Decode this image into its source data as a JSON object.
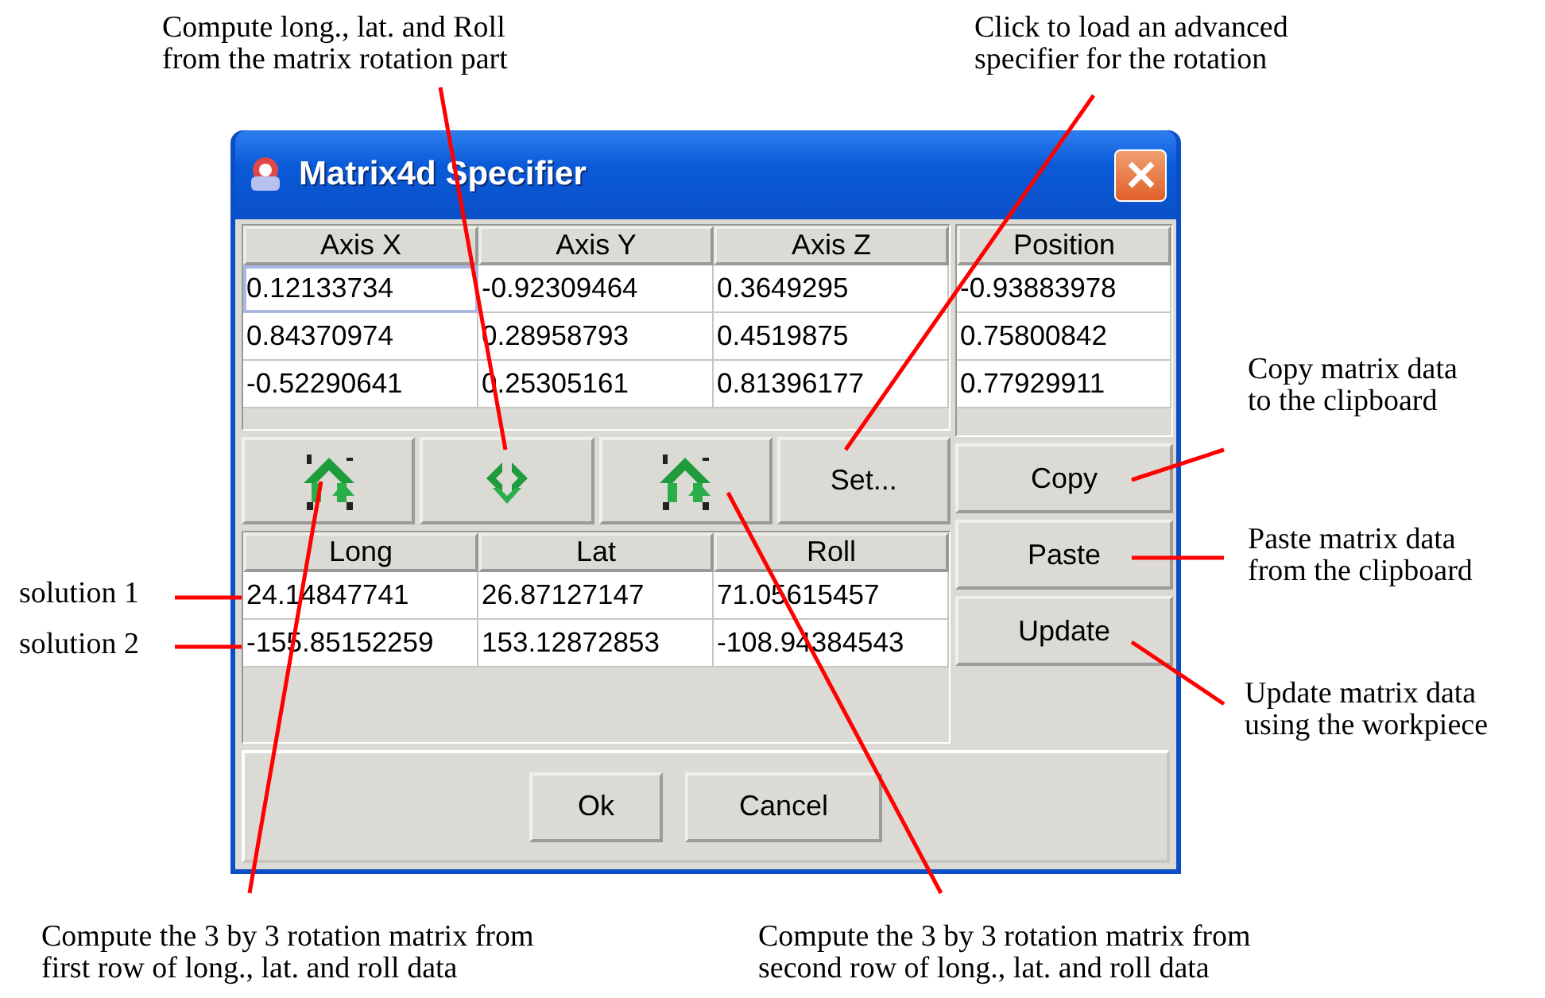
{
  "window": {
    "title": "Matrix4d Specifier"
  },
  "matrix_table": {
    "columns": [
      "Axis X",
      "Axis Y",
      "Axis Z"
    ],
    "rows": [
      {
        "cells": [
          {
            "value": "0.12133734",
            "selected": true
          },
          {
            "value": "-0.92309464",
            "selected": false
          },
          {
            "value": "0.3649295",
            "selected": false
          }
        ]
      },
      {
        "cells": [
          {
            "value": "0.84370974",
            "selected": false
          },
          {
            "value": "0.28958793",
            "selected": false
          },
          {
            "value": "0.4519875",
            "selected": false
          }
        ]
      },
      {
        "cells": [
          {
            "value": "-0.52290641",
            "selected": false
          },
          {
            "value": "0.25305161",
            "selected": false
          },
          {
            "value": "0.81396177",
            "selected": false
          }
        ]
      }
    ]
  },
  "position_table": {
    "column": "Position",
    "rows": [
      "-0.93883978",
      "0.75800842",
      "0.77929911"
    ]
  },
  "rotation_buttons": [
    {
      "kind": "row1-to-matrix"
    },
    {
      "kind": "matrix-to-angles"
    },
    {
      "kind": "row2-to-matrix"
    },
    {
      "kind": "text",
      "label": "Set..."
    }
  ],
  "angles_table": {
    "columns": [
      "Long",
      "Lat",
      "Roll"
    ],
    "rows": [
      [
        "24.14847741",
        "26.87127147",
        "71.05615457"
      ],
      [
        "-155.85152259",
        "153.12872853",
        "-108.94384543"
      ]
    ]
  },
  "side_buttons": [
    "Copy",
    "Paste",
    "Update"
  ],
  "dialog_buttons": [
    "Ok",
    "Cancel"
  ],
  "annotations": [
    {
      "text": "Compute long., lat. and Roll\nfrom the matrix rotation part"
    },
    {
      "text": "Click to load an advanced\nspecifier for the rotation"
    },
    {
      "text": "Copy matrix data\nto the clipboard"
    },
    {
      "text": "Paste matrix data\nfrom the clipboard"
    },
    {
      "text": "Update matrix data\nusing the workpiece"
    },
    {
      "text": "solution 1"
    },
    {
      "text": "solution 2"
    },
    {
      "text": "Compute the 3 by 3 rotation matrix from\nfirst row of long., lat. and roll data"
    },
    {
      "text": "Compute the 3 by 3 rotation matrix from\nsecond row of long., lat. and roll data"
    }
  ]
}
